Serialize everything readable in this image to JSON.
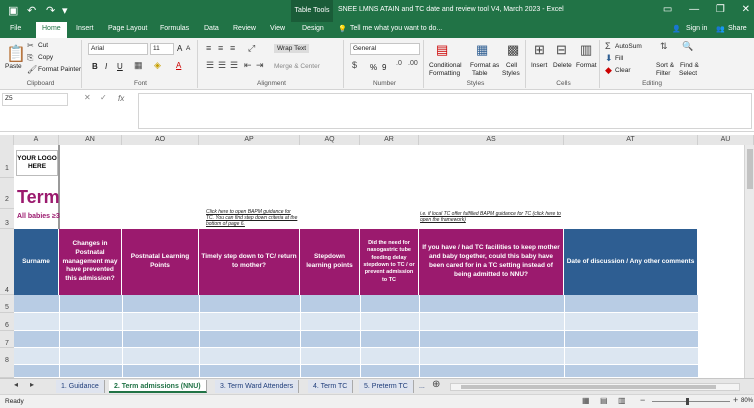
{
  "titlebar": {
    "table_tools": "Table Tools",
    "title": "SNEE LMNS ATAIN and TC date and review tool V4, March 2023 - Excel"
  },
  "ribbon_tabs": [
    "File",
    "Home",
    "Insert",
    "Page Layout",
    "Formulas",
    "Data",
    "Review",
    "View",
    "Design"
  ],
  "tell_me": "Tell me what you want to do...",
  "signin": "Sign in",
  "share": "Share",
  "clipboard": {
    "paste": "Paste",
    "cut": "Cut",
    "copy": "Copy",
    "format_painter": "Format Painter",
    "label": "Clipboard"
  },
  "font": {
    "name": "Arial",
    "size": "11",
    "label": "Font",
    "bold": "B",
    "italic": "I",
    "underline": "U"
  },
  "alignment": {
    "wrap_text": "Wrap Text",
    "merge_center": "Merge & Center",
    "label": "Alignment"
  },
  "number": {
    "format": "General",
    "percent": "%",
    "comma": "9",
    "label": "Number"
  },
  "styles": {
    "conditional": "Conditional",
    "formatting": "Formatting",
    "format_as": "Format as",
    "table": "Table",
    "cell": "Cell",
    "styles": "Styles",
    "label": "Styles"
  },
  "cells": {
    "insert": "Insert",
    "delete": "Delete",
    "format": "Format",
    "label": "Cells"
  },
  "editing": {
    "autosum": "AutoSum",
    "fill": "Fill",
    "clear": "Clear",
    "sort": "Sort &",
    "filter": "Filter",
    "find": "Find &",
    "select": "Select",
    "label": "Editing"
  },
  "formula_bar": {
    "name_box": "Z5",
    "fx": "fx",
    "value": ""
  },
  "columns": [
    "A",
    "AN",
    "AO",
    "AP",
    "AQ",
    "AR",
    "AS",
    "AT",
    "AU"
  ],
  "rows": [
    "1",
    "2",
    "3",
    "4",
    "5",
    "6",
    "7",
    "8"
  ],
  "logo": {
    "line1": "YOUR LOGO",
    "line2": "HERE"
  },
  "sheet_title": "Term",
  "sheet_subtitle": "All babies ≥3",
  "note_ap": "Click here to open BAPM guidance for TC. You can find step down criteria at the bottom of page 6.",
  "note_as": "i.e. if local TC offer fulfilled BAPM guidance for TC (click here to open the framework)",
  "headers": [
    "Surname",
    "Changes in Postnatal management may have prevented this admission?",
    "Postnatal Learning Points",
    "Timely step down to TC/ return to mother?",
    "Stepdown learning points",
    "Did the need for nasogastric tube feeding delay stepdown to TC / or prevent admission to TC",
    "If you have / had TC facilities to keep mother and baby together, could this baby have been cared for in a TC setting instead of being admitted to NNU?",
    "Date of discussion / Any other comments"
  ],
  "sheet_tabs": [
    "1. Guidance",
    "2. Term admissions (NNU)",
    "3. Term Ward Attenders",
    "4. Term TC",
    "5. Preterm TC",
    "..."
  ],
  "status": {
    "ready": "Ready",
    "zoom": "80%"
  },
  "colors": {
    "excel_green": "#217346",
    "magenta": "#9b1a6e",
    "blue_header": "#2e5e92",
    "band_dark": "#b8cce4",
    "band_light": "#dce6f1"
  }
}
